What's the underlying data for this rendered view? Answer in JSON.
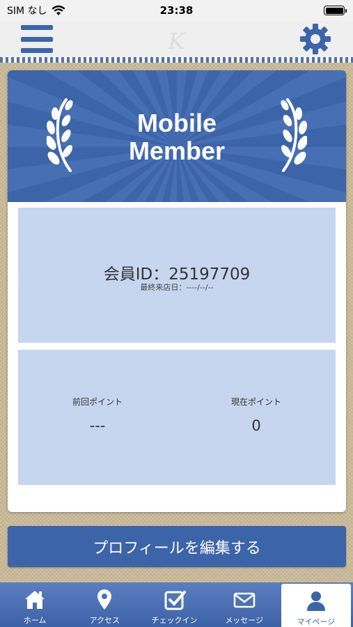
{
  "status_bar": {
    "carrier": "SIM なし",
    "time": "23:38",
    "battery_level": 1.0
  },
  "header": {
    "logo_text": "K",
    "menu_icon": "hamburger-icon",
    "settings_icon": "gear-icon"
  },
  "card": {
    "banner_title_line1": "Mobile",
    "banner_title_line2": "Member",
    "member_id_label": "会員ID：25197709",
    "last_visit_label": "最終来店日：----/--/--",
    "previous_points_label": "前回ポイント",
    "previous_points_value": "---",
    "current_points_label": "現在ポイント",
    "current_points_value": "0"
  },
  "edit_profile_button": "プロフィールを編集する",
  "tabs": [
    {
      "label": "ホーム",
      "icon": "home-icon",
      "active": false
    },
    {
      "label": "アクセス",
      "icon": "map-pin-icon",
      "active": false
    },
    {
      "label": "チェックイン",
      "icon": "checkbox-icon",
      "active": false
    },
    {
      "label": "メッセージ",
      "icon": "envelope-icon",
      "active": false
    },
    {
      "label": "マイページ",
      "icon": "user-icon",
      "active": true
    }
  ],
  "colors": {
    "primary": "#3c64a8",
    "panel": "#c6d6ef",
    "background": "#cbbb98"
  }
}
